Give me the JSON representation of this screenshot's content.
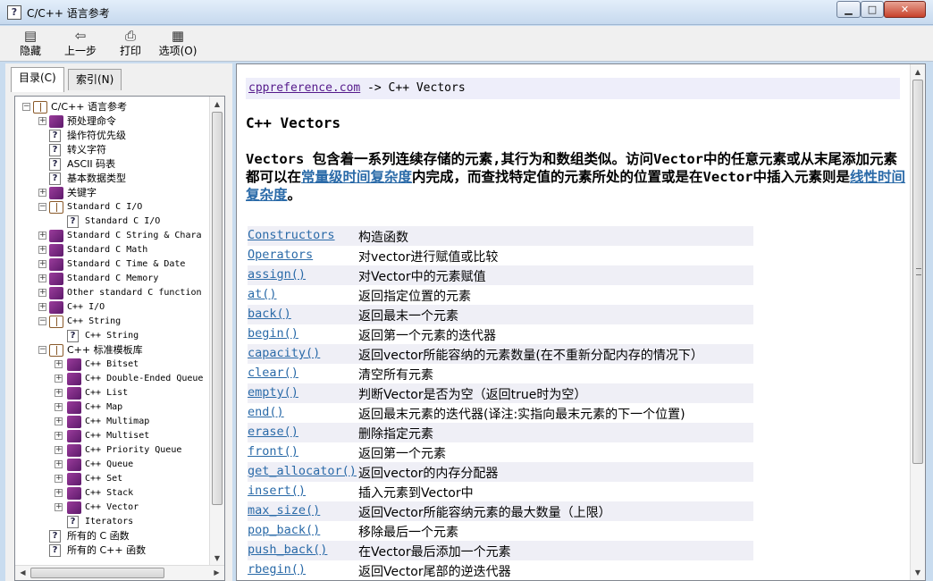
{
  "window": {
    "title": "C/C++ 语言参考",
    "icon": "help-icon"
  },
  "toolbar": {
    "buttons": [
      {
        "label": "隐藏",
        "icon": "hide-icon"
      },
      {
        "label": "上一步",
        "icon": "back-arrow-icon"
      },
      {
        "label": "打印",
        "icon": "printer-icon"
      },
      {
        "label": "选项(O)",
        "icon": "options-icon"
      }
    ]
  },
  "tabs": [
    {
      "label": "目录(C)",
      "active": true
    },
    {
      "label": "索引(N)",
      "active": false
    }
  ],
  "tree": [
    {
      "label": "C/C++ 语言参考",
      "level": 0,
      "icon": "book-open",
      "exp": "−"
    },
    {
      "label": "预处理命令",
      "level": 1,
      "icon": "book",
      "exp": "+"
    },
    {
      "label": "操作符优先级",
      "level": 1,
      "icon": "page",
      "exp": ""
    },
    {
      "label": "转义字符",
      "level": 1,
      "icon": "page",
      "exp": ""
    },
    {
      "label": "ASCII 码表",
      "level": 1,
      "icon": "page",
      "exp": ""
    },
    {
      "label": "基本数据类型",
      "level": 1,
      "icon": "page",
      "exp": ""
    },
    {
      "label": "关键字",
      "level": 1,
      "icon": "book",
      "exp": "+"
    },
    {
      "label": "Standard C I/O",
      "level": 1,
      "icon": "book-open",
      "exp": "−"
    },
    {
      "label": "Standard C I/O",
      "level": 2,
      "icon": "page",
      "exp": ""
    },
    {
      "label": "Standard C String & Chara",
      "level": 1,
      "icon": "book",
      "exp": "+"
    },
    {
      "label": "Standard C Math",
      "level": 1,
      "icon": "book",
      "exp": "+"
    },
    {
      "label": "Standard C Time & Date",
      "level": 1,
      "icon": "book",
      "exp": "+"
    },
    {
      "label": "Standard C Memory",
      "level": 1,
      "icon": "book",
      "exp": "+"
    },
    {
      "label": "Other standard C function",
      "level": 1,
      "icon": "book",
      "exp": "+"
    },
    {
      "label": "C++ I/O",
      "level": 1,
      "icon": "book",
      "exp": "+"
    },
    {
      "label": "C++ String",
      "level": 1,
      "icon": "book-open",
      "exp": "−"
    },
    {
      "label": "C++ String",
      "level": 2,
      "icon": "page",
      "exp": ""
    },
    {
      "label": "C++ 标准模板库",
      "level": 1,
      "icon": "book-open",
      "exp": "−"
    },
    {
      "label": "C++ Bitset",
      "level": 2,
      "icon": "book",
      "exp": "+"
    },
    {
      "label": "C++ Double-Ended Queue",
      "level": 2,
      "icon": "book",
      "exp": "+"
    },
    {
      "label": "C++ List",
      "level": 2,
      "icon": "book",
      "exp": "+"
    },
    {
      "label": "C++ Map",
      "level": 2,
      "icon": "book",
      "exp": "+"
    },
    {
      "label": "C++ Multimap",
      "level": 2,
      "icon": "book",
      "exp": "+"
    },
    {
      "label": "C++ Multiset",
      "level": 2,
      "icon": "book",
      "exp": "+"
    },
    {
      "label": "C++ Priority Queue",
      "level": 2,
      "icon": "book",
      "exp": "+"
    },
    {
      "label": "C++ Queue",
      "level": 2,
      "icon": "book",
      "exp": "+"
    },
    {
      "label": "C++ Set",
      "level": 2,
      "icon": "book",
      "exp": "+"
    },
    {
      "label": "C++ Stack",
      "level": 2,
      "icon": "book",
      "exp": "+"
    },
    {
      "label": "C++ Vector",
      "level": 2,
      "icon": "book",
      "exp": "+"
    },
    {
      "label": "Iterators",
      "level": 2,
      "icon": "page",
      "exp": ""
    },
    {
      "label": "所有的 C 函数",
      "level": 1,
      "icon": "page",
      "exp": ""
    },
    {
      "label": "所有的 C++ 函数",
      "level": 1,
      "icon": "page",
      "exp": ""
    }
  ],
  "content": {
    "breadcrumb": {
      "link": "cppreference.com",
      "separator": " -> ",
      "current": "C++ Vectors"
    },
    "title": "C++ Vectors",
    "intro": {
      "part1": "Vectors 包含着一系列连续存储的元素,其行为和数组类似。访问Vector中的任意元素或从末尾添加元素都可以在",
      "link1": "常量级时间复杂度",
      "part2": "内完成，而查找特定值的元素所处的位置或是在Vector中插入元素则是",
      "link2": "线性时间复杂度",
      "part3": "。"
    },
    "methods": [
      {
        "name": "Constructors",
        "desc": "构造函数"
      },
      {
        "name": "Operators",
        "desc": "对vector进行赋值或比较"
      },
      {
        "name": "assign()",
        "desc": "对Vector中的元素赋值"
      },
      {
        "name": "at()",
        "desc": "返回指定位置的元素"
      },
      {
        "name": "back()",
        "desc": "返回最末一个元素"
      },
      {
        "name": "begin()",
        "desc": "返回第一个元素的迭代器"
      },
      {
        "name": "capacity()",
        "desc": "返回vector所能容纳的元素数量(在不重新分配内存的情况下）"
      },
      {
        "name": "clear()",
        "desc": "清空所有元素"
      },
      {
        "name": "empty()",
        "desc": "判断Vector是否为空（返回true时为空）"
      },
      {
        "name": "end()",
        "desc": "返回最末元素的迭代器(译注:实指向最末元素的下一个位置)"
      },
      {
        "name": "erase()",
        "desc": "删除指定元素"
      },
      {
        "name": "front()",
        "desc": "返回第一个元素"
      },
      {
        "name": "get_allocator()",
        "desc": "返回vector的内存分配器"
      },
      {
        "name": "insert()",
        "desc": "插入元素到Vector中"
      },
      {
        "name": "max_size()",
        "desc": "返回Vector所能容纳元素的最大数量（上限）"
      },
      {
        "name": "pop_back()",
        "desc": "移除最后一个元素"
      },
      {
        "name": "push_back()",
        "desc": "在Vector最后添加一个元素"
      },
      {
        "name": "rbegin()",
        "desc": "返回Vector尾部的逆迭代器"
      }
    ]
  }
}
